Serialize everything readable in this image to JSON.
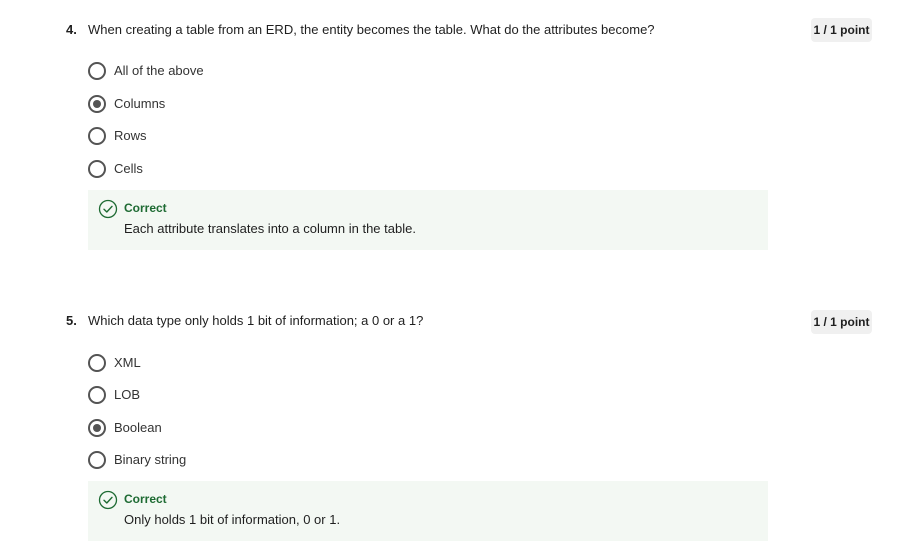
{
  "questions": [
    {
      "number": "4.",
      "text": "When creating a table from an ERD, the entity becomes the table. What do the attributes become?",
      "points": "1 / 1 point",
      "options": [
        {
          "label": "All of the above",
          "selected": false
        },
        {
          "label": "Columns",
          "selected": true
        },
        {
          "label": "Rows",
          "selected": false
        },
        {
          "label": "Cells",
          "selected": false
        }
      ],
      "feedback": {
        "title": "Correct",
        "text": "Each attribute translates into a column in the table."
      }
    },
    {
      "number": "5.",
      "text": "Which data type only holds 1 bit of information; a 0 or a 1?",
      "points": "1 / 1 point",
      "options": [
        {
          "label": "XML",
          "selected": false
        },
        {
          "label": "LOB",
          "selected": false
        },
        {
          "label": "Boolean",
          "selected": true
        },
        {
          "label": "Binary string",
          "selected": false
        }
      ],
      "feedback": {
        "title": "Correct",
        "text": "Only holds 1 bit of information, 0 or 1."
      }
    }
  ],
  "colors": {
    "correct": "#1e6b33",
    "feedback_bg": "#f3f8f3",
    "radio": "#545454"
  }
}
